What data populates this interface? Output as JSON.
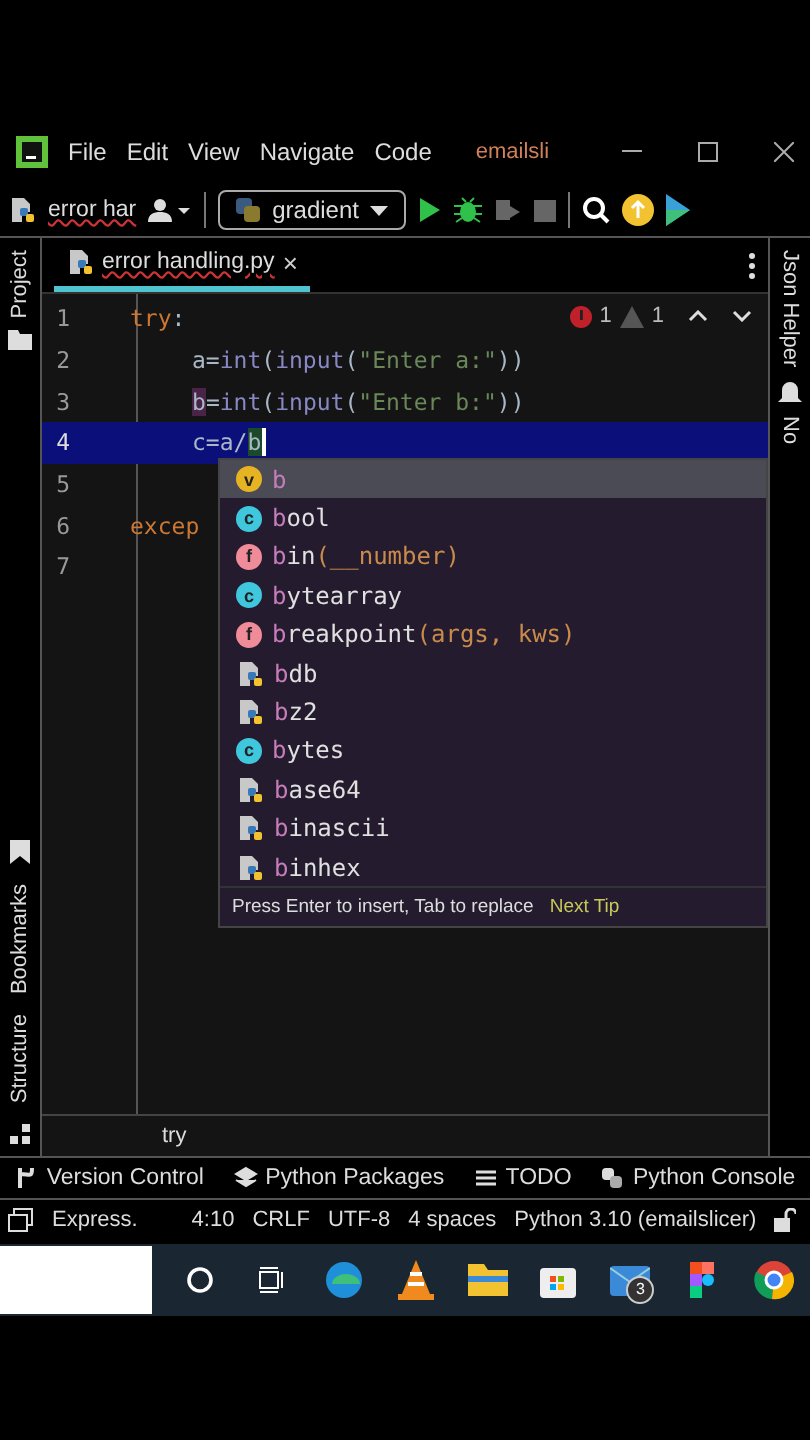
{
  "menu_bar": {
    "items": [
      "File",
      "Edit",
      "View",
      "Navigate",
      "Code"
    ],
    "project_title": "emailsli"
  },
  "toolbar": {
    "current_file": "error har",
    "run_config": "gradient"
  },
  "left_tool_windows": [
    "Project",
    "Bookmarks",
    "Structure"
  ],
  "right_tool_windows": [
    "Json Helper",
    "No"
  ],
  "editor_tab": {
    "label": "error handling.py",
    "close": "×",
    "selected": true
  },
  "inspections": {
    "errors": "1",
    "warnings": "1"
  },
  "code_lines": [
    {
      "number": "1",
      "current": false,
      "tokens": [
        {
          "text": "try",
          "kind": "keyword"
        },
        {
          "text": ":",
          "kind": "plain"
        }
      ],
      "children": [
        {
          "number": "2",
          "current": false,
          "tokens": [
            {
              "text": "a=",
              "kind": "plain"
            },
            {
              "text": "int",
              "kind": "builtin"
            },
            {
              "text": "(",
              "kind": "plain"
            },
            {
              "text": "input",
              "kind": "builtin"
            },
            {
              "text": "(",
              "kind": "plain"
            },
            {
              "text": "\"Enter a:\"",
              "kind": "string"
            },
            {
              "text": "))",
              "kind": "plain"
            }
          ]
        },
        {
          "number": "3",
          "current": false,
          "tokens": [
            {
              "text": "b",
              "kind": "usage"
            },
            {
              "text": "=",
              "kind": "plain"
            },
            {
              "text": "int",
              "kind": "builtin"
            },
            {
              "text": "(",
              "kind": "plain"
            },
            {
              "text": "input",
              "kind": "builtin"
            },
            {
              "text": "(",
              "kind": "plain"
            },
            {
              "text": "\"Enter b:\"",
              "kind": "string"
            },
            {
              "text": "))",
              "kind": "plain"
            }
          ]
        },
        {
          "number": "4",
          "current": true,
          "tokens": [
            {
              "text": "c=a/",
              "kind": "plain"
            },
            {
              "text": "b",
              "kind": "caret"
            }
          ]
        }
      ]
    },
    {
      "number": "5",
      "current": false
    },
    {
      "number": "6",
      "current": false,
      "tokens": [
        {
          "text": "excep",
          "kind": "keyword"
        }
      ]
    },
    {
      "number": "7",
      "current": false
    }
  ],
  "completion": {
    "items": [
      {
        "kind": "variable",
        "badge": "v",
        "name": "b",
        "selected": true
      },
      {
        "kind": "class",
        "badge": "c",
        "name": "bool",
        "selected": false
      },
      {
        "kind": "function",
        "badge": "f",
        "name": "bin",
        "params": "(__number)",
        "selected": false
      },
      {
        "kind": "class",
        "badge": "c",
        "name": "bytearray",
        "selected": false
      },
      {
        "kind": "function",
        "badge": "f",
        "name": "breakpoint",
        "params": "(args, kws)",
        "selected": false
      },
      {
        "kind": "module",
        "name": "bdb",
        "selected": false
      },
      {
        "kind": "module",
        "name": "bz2",
        "selected": false
      },
      {
        "kind": "class",
        "badge": "c",
        "name": "bytes",
        "selected": false
      },
      {
        "kind": "module",
        "name": "base64",
        "selected": false
      },
      {
        "kind": "module",
        "name": "binascii",
        "selected": false
      },
      {
        "kind": "module",
        "name": "binhex",
        "selected": false
      }
    ],
    "hint": "Press Enter to insert, Tab to replace",
    "tip_link": "Next Tip"
  },
  "breadcrumb": "try",
  "tool_window_bar": [
    "Version Control",
    "Python Packages",
    "TODO",
    "Python Console"
  ],
  "status_bar": [
    "Express.",
    "4:10",
    "CRLF",
    "UTF-8",
    "4 spaces",
    "Python 3.10 (emailslicer)"
  ],
  "taskbar": {
    "mail_badge": "3"
  }
}
